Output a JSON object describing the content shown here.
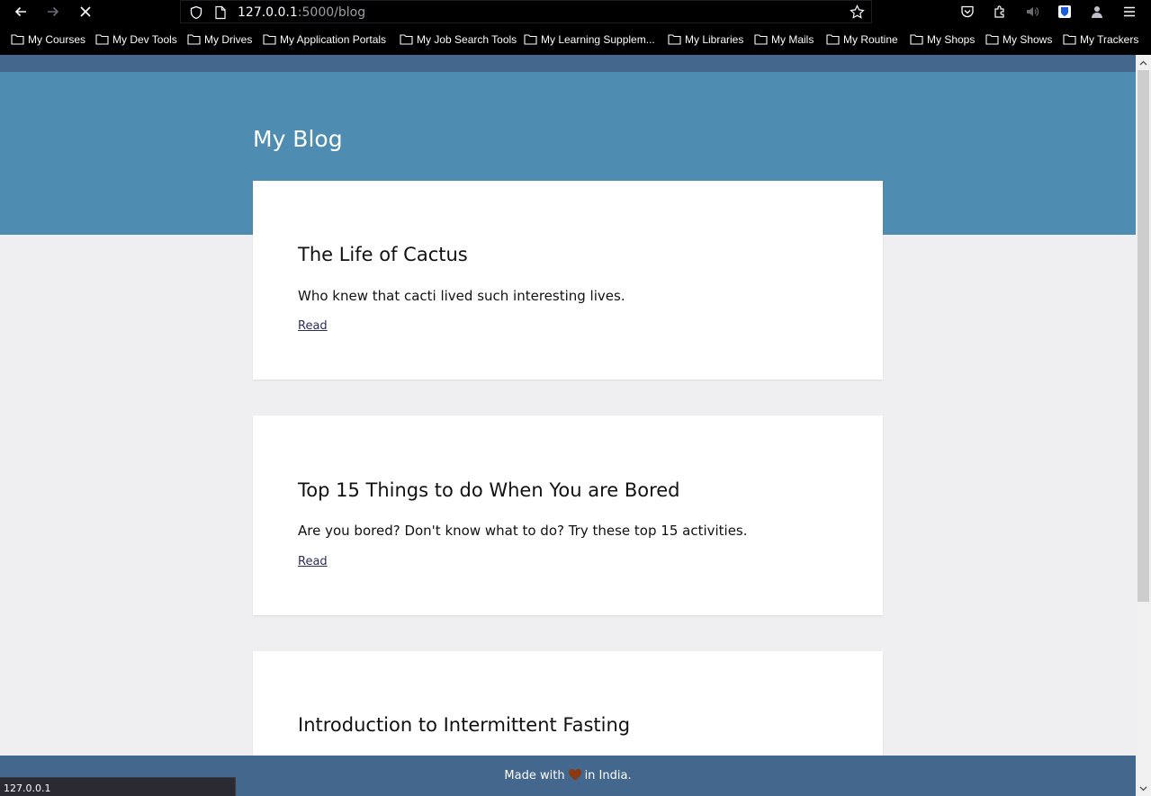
{
  "browser": {
    "url_host": "127.0.0.1",
    "url_path": ":5000/blog",
    "status_text": "127.0.0.1"
  },
  "bookmarks": [
    "My Courses",
    "My Dev Tools",
    "My Drives",
    "My Application Portals",
    "My Job Search Tools",
    "My Learning Supplem...",
    "My Libraries",
    "My Mails",
    "My Routine",
    "My Shops",
    "My Shows",
    "My Trackers"
  ],
  "page": {
    "title": "My Blog",
    "posts": [
      {
        "title": "The Life of Cactus",
        "description": "Who knew that cacti lived such interesting lives.",
        "link_label": "Read"
      },
      {
        "title": "Top 15 Things to do When You are Bored",
        "description": "Are you bored? Don't know what to do? Try these top 15 activities.",
        "link_label": "Read"
      },
      {
        "title": "Introduction to Intermittent Fasting",
        "description": "",
        "link_label": ""
      }
    ],
    "footer": {
      "before": "Made with",
      "after": "in India."
    }
  },
  "colors": {
    "hero": "#4e8cb1",
    "footer": "#44678e",
    "link": "#2c2f5c",
    "heart": "#8b3a0f"
  }
}
